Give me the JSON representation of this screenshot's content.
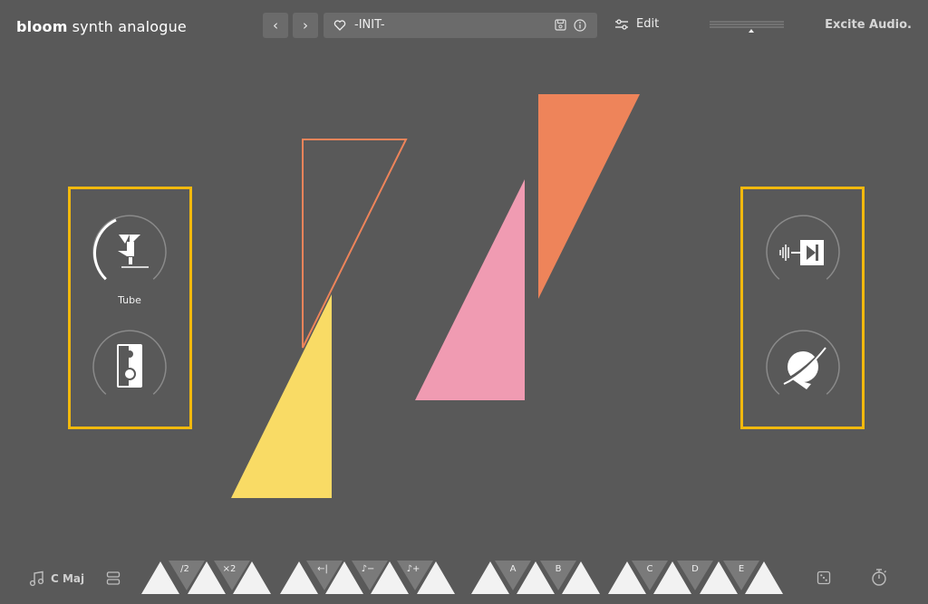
{
  "header": {
    "brand_bold": "bloom",
    "brand_rest": "synth analogue",
    "preset_name": "-INIT-",
    "edit_label": "Edit",
    "company": "Excite Audio."
  },
  "left_panel": {
    "knob_top_label": "Tube",
    "knob_top_icon": "tube-distortion-icon",
    "knob_bottom_icon": "speaker-icon"
  },
  "right_panel": {
    "knob_top_icon": "compressor-icon",
    "knob_bottom_icon": "orbit-icon"
  },
  "footer": {
    "scale_label": "C Maj",
    "pads": {
      "half": "/2",
      "double": "×2",
      "back": "←|",
      "note_minus": "♪−",
      "note_plus": "♪+",
      "a": "A",
      "b": "B",
      "c": "C",
      "d": "D",
      "e": "E"
    }
  },
  "colors": {
    "background": "#595959",
    "highlight": "#f2b90d",
    "orange": "#ee845a",
    "pink": "#f09bb2",
    "yellow": "#f9db65"
  }
}
